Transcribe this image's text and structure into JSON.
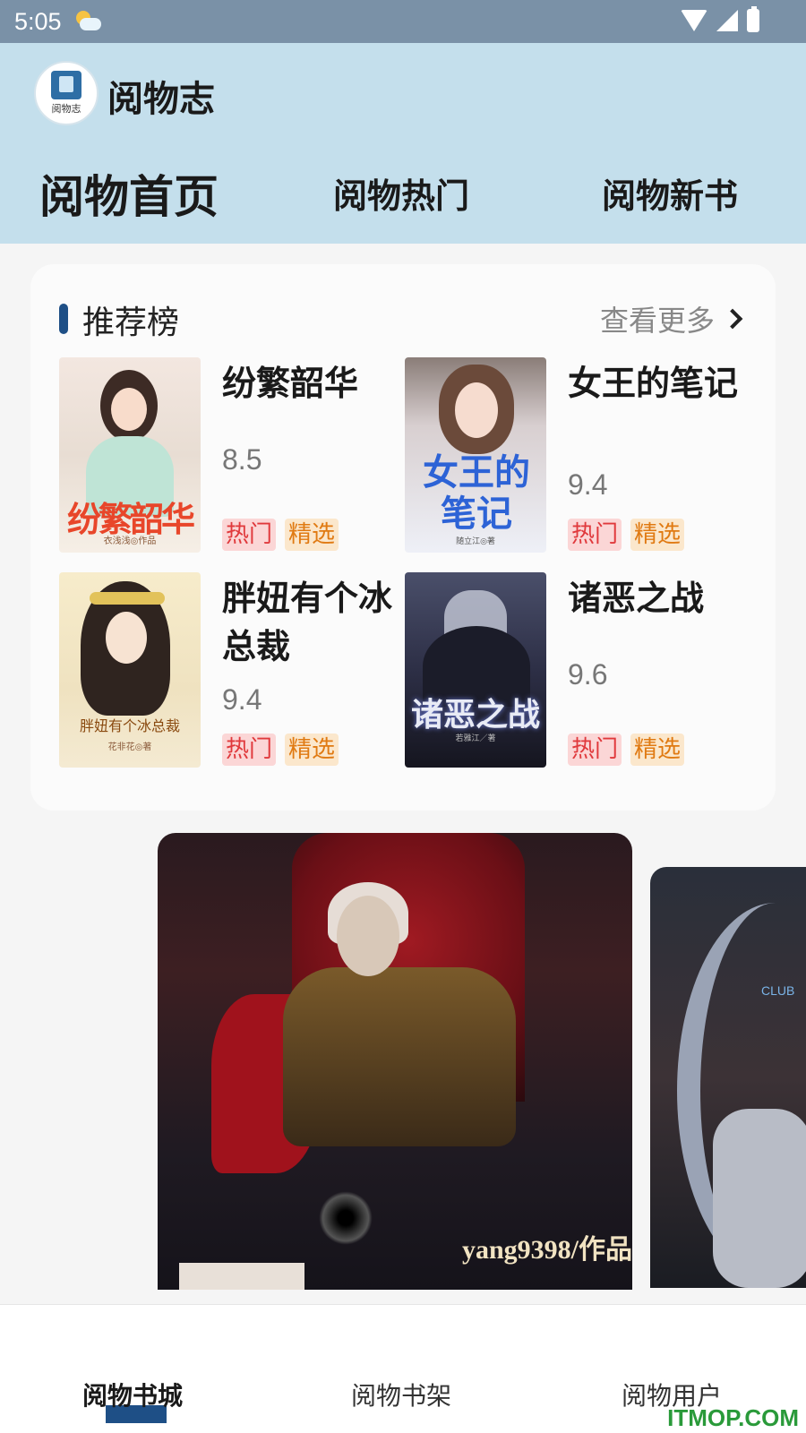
{
  "status_bar": {
    "time": "5:05"
  },
  "header": {
    "logo_text": "阅物志",
    "app_title": "阅物志",
    "tabs": [
      {
        "label": "阅物首页",
        "active": true
      },
      {
        "label": "阅物热门",
        "active": false
      },
      {
        "label": "阅物新书",
        "active": false
      }
    ]
  },
  "recommend": {
    "title": "推荐榜",
    "more_label": "查看更多",
    "books": [
      {
        "name": "纷繁韶华",
        "score": "8.5",
        "tags": [
          "热门",
          "精选"
        ],
        "cover_title": "纷繁韶华",
        "cover_author": "衣浅浅◎作品"
      },
      {
        "name": "女王的笔记",
        "score": "9.4",
        "tags": [
          "热门",
          "精选"
        ],
        "cover_title": "女王的笔记",
        "cover_author": "随立江◎著"
      },
      {
        "name": "胖妞有个冰总裁",
        "score": "9.4",
        "tags": [
          "热门",
          "精选"
        ],
        "cover_title": "胖妞有个冰总裁",
        "cover_author": "花非花◎著"
      },
      {
        "name": "诸恶之战",
        "score": "9.6",
        "tags": [
          "热门",
          "精选"
        ],
        "cover_title": "诸恶之战",
        "cover_author": "若雅江／著"
      }
    ]
  },
  "banner": {
    "main_caption": "yang9398/作品",
    "side_sign": "CLUB"
  },
  "bottom_nav": {
    "items": [
      {
        "label": "阅物书城",
        "active": true
      },
      {
        "label": "阅物书架",
        "active": false
      },
      {
        "label": "阅物用户",
        "active": false
      }
    ]
  },
  "watermark": "ITMOP.COM",
  "colors": {
    "accent": "#1e4f86",
    "header_bg": "#c4dfec",
    "status_bar": "#7a91a7",
    "tag_hot": "#e0393c",
    "tag_pick": "#e07a12"
  }
}
